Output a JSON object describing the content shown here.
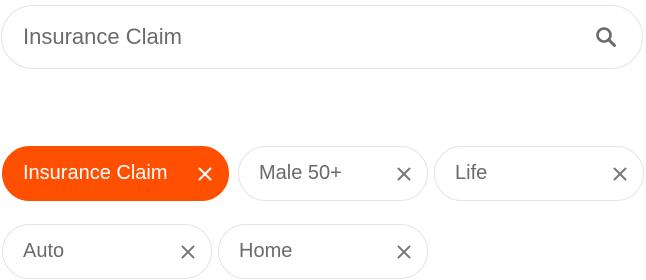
{
  "search": {
    "placeholder": "Insurance Claim",
    "icon": "search-icon"
  },
  "colors": {
    "accent": "#ff4f00",
    "chip_border": "#e4e4e4",
    "text_muted": "#6b6b6b"
  },
  "chips": [
    {
      "label": "Insurance Claim",
      "active": true,
      "icon": "close-icon"
    },
    {
      "label": "Male 50+",
      "active": false,
      "icon": "close-icon"
    },
    {
      "label": "Life",
      "active": false,
      "icon": "close-icon"
    },
    {
      "label": "Auto",
      "active": false,
      "icon": "close-icon"
    },
    {
      "label": "Home",
      "active": false,
      "icon": "close-icon"
    }
  ]
}
